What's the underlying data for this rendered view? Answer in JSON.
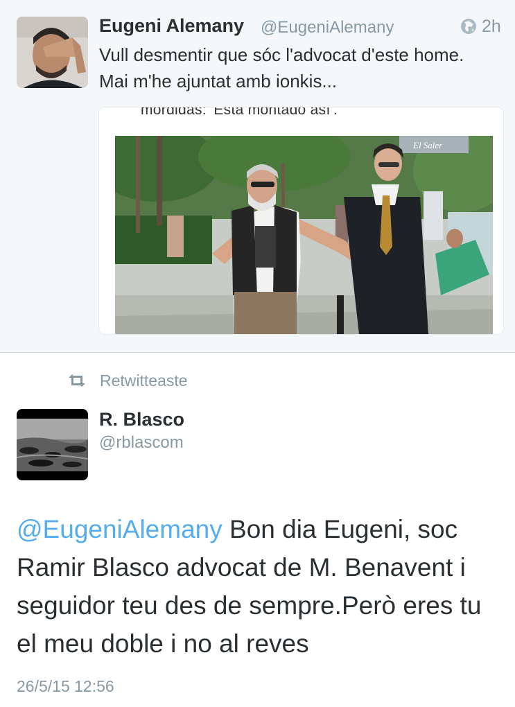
{
  "tweet1": {
    "author_name": "Eugeni Alemany",
    "author_handle": "@EugeniAlemany",
    "time": "2h",
    "text": "Vull desmentir que sóc l'advocat d'este home. Mai m'he ajuntat amb ionkis...",
    "media_caption": "mordidas: 'Esta montado así'.",
    "photo_sign": "El Saler",
    "globe_icon": "globe-icon"
  },
  "retweet": {
    "label": "Retwitteaste",
    "icon": "retweet-icon"
  },
  "tweet2": {
    "author_name": "R. Blasco",
    "author_handle": "@rblascom",
    "mention": "@EugeniAlemany",
    "text": " Bon dia Eugeni, soc Ramir Blasco advocat de M. Benavent i seguidor teu des de sempre.Però eres tu el meu doble i no al reves",
    "date": "26/5/15 12:56"
  },
  "colors": {
    "accent": "#55acee",
    "muted": "#8899a6",
    "text": "#292f33",
    "top_bg": "#f5f8fa"
  }
}
